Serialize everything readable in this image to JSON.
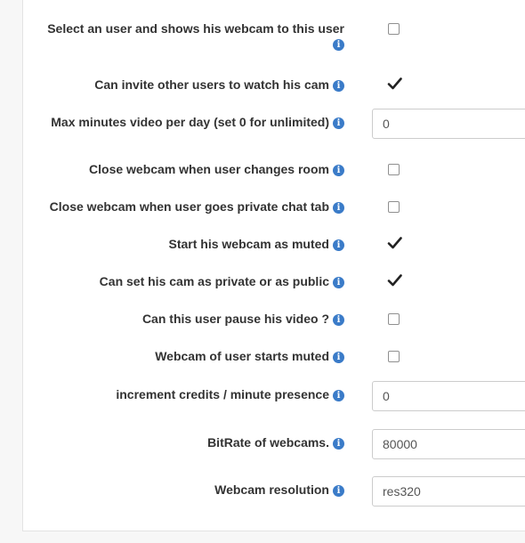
{
  "settings": [
    {
      "label": "Select an user and shows his webcam to this user",
      "type": "checkbox",
      "checked": false
    },
    {
      "label": "Can invite other users to watch his cam",
      "type": "checkbox",
      "checked": true
    },
    {
      "label": "Max minutes video per day (set 0 for unlimited)",
      "type": "text",
      "value": "0"
    },
    {
      "label": "Close webcam when user changes room",
      "type": "checkbox",
      "checked": false
    },
    {
      "label": "Close webcam when user goes private chat tab",
      "type": "checkbox",
      "checked": false
    },
    {
      "label": "Start his webcam as muted",
      "type": "checkbox",
      "checked": true
    },
    {
      "label": "Can set his cam as private or as public",
      "type": "checkbox",
      "checked": true
    },
    {
      "label": "Can this user pause his video ?",
      "type": "checkbox",
      "checked": false
    },
    {
      "label": "Webcam of user starts muted",
      "type": "checkbox",
      "checked": false
    },
    {
      "label": "increment credits / minute presence",
      "type": "text",
      "value": "0"
    },
    {
      "label": "BitRate of webcams.",
      "type": "text",
      "value": "80000"
    },
    {
      "label": "Webcam resolution",
      "type": "select",
      "value": "res320"
    }
  ],
  "icons": {
    "info": "info-icon",
    "check": "checkmark-icon"
  },
  "colors": {
    "info_icon": "#3a7bc8",
    "label_text": "#333333",
    "input_border": "#cccccc"
  }
}
